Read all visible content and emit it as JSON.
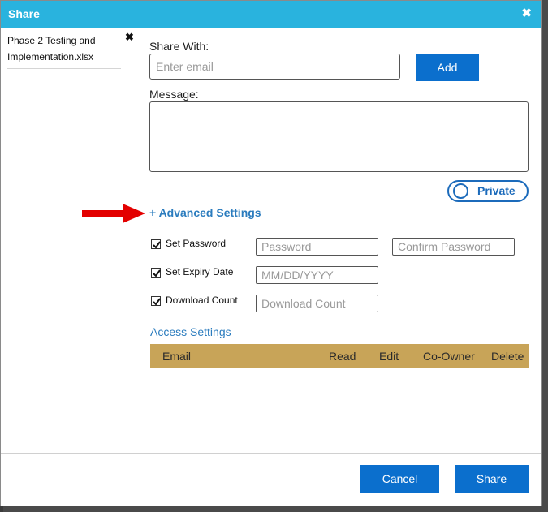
{
  "window": {
    "title": "Share"
  },
  "files": [
    {
      "name": "Phase 2 Testing and Implementation.xlsx"
    }
  ],
  "share_with": {
    "label": "Share With:",
    "email_placeholder": "Enter email",
    "add_label": "Add"
  },
  "message": {
    "label": "Message:",
    "value": ""
  },
  "visibility_toggle": {
    "label": "Private"
  },
  "advanced": {
    "label": "Advanced Settings",
    "prefix": "+",
    "set_password": {
      "label": "Set Password",
      "checked": true,
      "password_placeholder": "Password",
      "confirm_placeholder": "Confirm Password"
    },
    "set_expiry": {
      "label": "Set Expiry Date",
      "checked": true,
      "date_placeholder": "MM/DD/YYYY"
    },
    "download_count": {
      "label": "Download Count",
      "checked": true,
      "count_placeholder": "Download Count"
    }
  },
  "access_settings": {
    "label": "Access Settings",
    "columns": [
      "Email",
      "Read",
      "Edit",
      "Co-Owner",
      "Delete"
    ],
    "rows": []
  },
  "footer": {
    "cancel_label": "Cancel",
    "share_label": "Share"
  },
  "colors": {
    "title_bar": "#29b3de",
    "primary_button": "#0b6fcd",
    "link": "#2b7cbe",
    "table_header": "#c8a458",
    "annotation_arrow": "#e30000"
  }
}
